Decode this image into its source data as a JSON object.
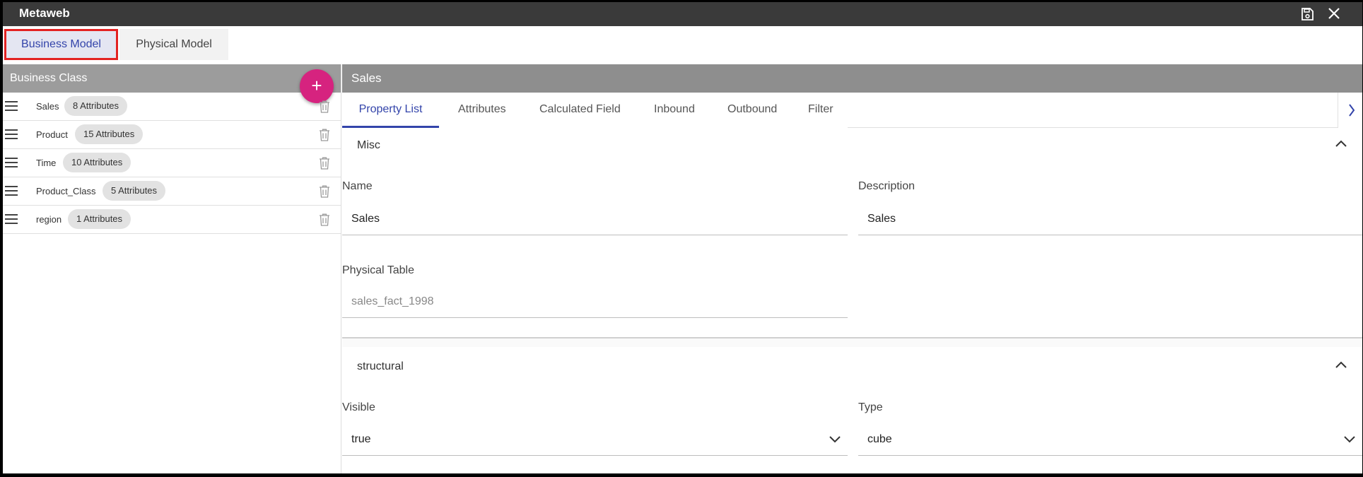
{
  "app": {
    "title": "Metaweb"
  },
  "model_tabs": {
    "business": "Business Model",
    "physical": "Physical Model"
  },
  "left": {
    "header": "Business Class",
    "add_label": "+",
    "classes": [
      {
        "name": "Sales",
        "badge": "8 Attributes"
      },
      {
        "name": "Product",
        "badge": "15 Attributes"
      },
      {
        "name": "Time",
        "badge": "10 Attributes"
      },
      {
        "name": "Product_Class",
        "badge": "5 Attributes"
      },
      {
        "name": "region",
        "badge": "1 Attributes"
      }
    ]
  },
  "right": {
    "header": "Sales",
    "tabs": [
      "Property List",
      "Attributes",
      "Calculated Field",
      "Inbound",
      "Outbound",
      "Filter"
    ],
    "active_tab": "Property List",
    "misc": {
      "title": "Misc",
      "name_label": "Name",
      "name_value": "Sales",
      "description_label": "Description",
      "description_value": "Sales",
      "physical_table_label": "Physical Table",
      "physical_table_value": "sales_fact_1998"
    },
    "structural": {
      "title": "structural",
      "visible_label": "Visible",
      "visible_value": "true",
      "type_label": "Type",
      "type_value": "cube"
    }
  },
  "colors": {
    "accent": "#3344aa",
    "fab": "#d6237f",
    "highlight_border": "#e32222"
  },
  "icons": [
    "save-icon",
    "close-icon",
    "drag-handle-icon",
    "trash-icon",
    "chevron-up-icon",
    "chevron-down-icon",
    "chevron-right-icon",
    "plus-icon"
  ]
}
